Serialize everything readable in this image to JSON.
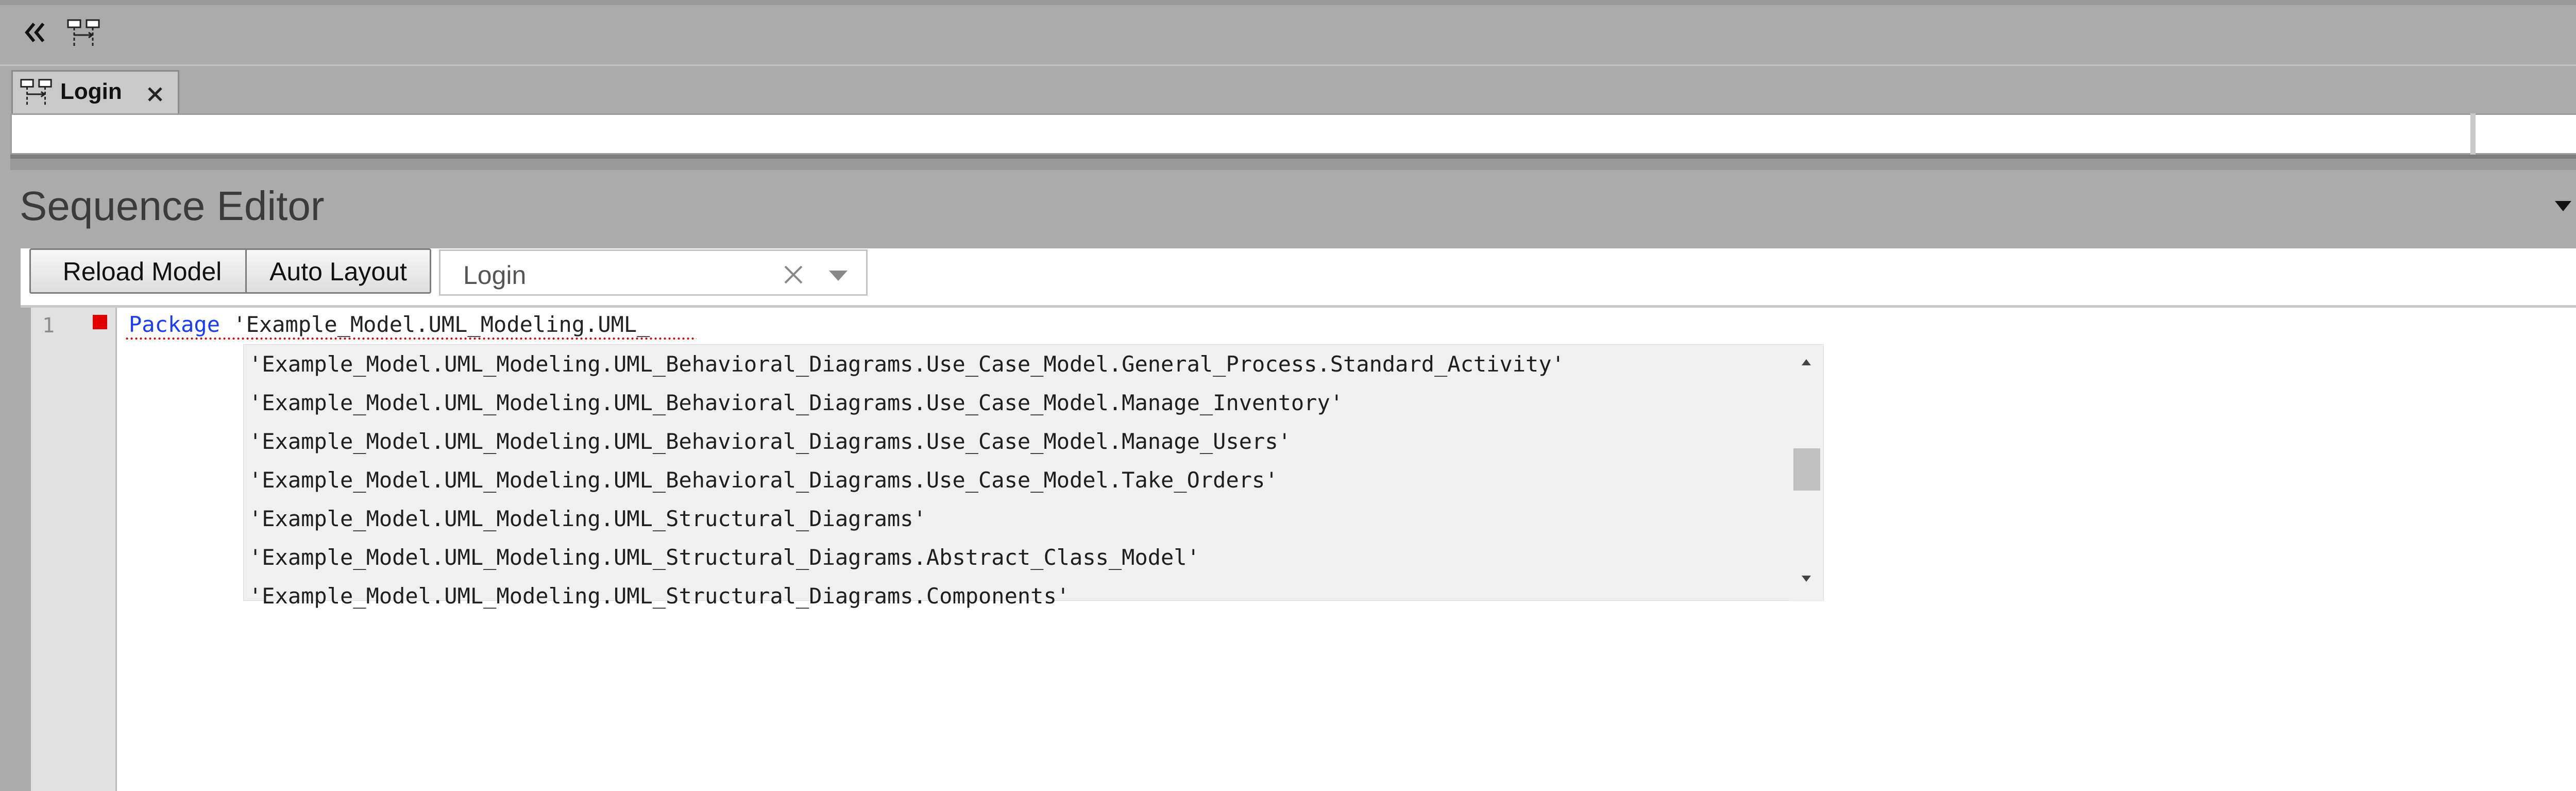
{
  "top_toolbar": {
    "collapse_icon": "double-chevron-left-icon",
    "diagram_icon": "sequence-diagram-icon",
    "dropdown_icon": "chevron-down-icon",
    "close_icon": "close-icon"
  },
  "tab_strip": {
    "tabs": [
      {
        "label": "Login",
        "icon": "sequence-diagram-icon",
        "active": true
      }
    ],
    "prev_icon": "triangle-left-icon",
    "next_icon": "triangle-right-icon"
  },
  "diagram_bar": {
    "dropdown_icon": "chevron-down-icon"
  },
  "panel": {
    "title": "Sequence Editor",
    "menu_icon": "chevron-down-icon",
    "pin_icon": "pin-icon",
    "close_icon": "close-icon"
  },
  "toolbar": {
    "reload_label": "Reload Model",
    "auto_layout_label": "Auto Layout",
    "sequence_select": {
      "value": "Login",
      "clear_icon": "clear-icon",
      "dropdown_icon": "chevron-down-icon"
    }
  },
  "editor": {
    "line_number": "1",
    "keyword": "Package",
    "string": "'Example_Model.UML_Modeling.UML_",
    "breakpoint_color": "#e10000",
    "keyword_color": "#1a3cff"
  },
  "autocomplete": {
    "items": [
      "'Example_Model.UML_Modeling.UML_Behavioral_Diagrams.Use_Case_Model.General_Process.Standard_Activity'",
      "'Example_Model.UML_Modeling.UML_Behavioral_Diagrams.Use_Case_Model.Manage_Inventory'",
      "'Example_Model.UML_Modeling.UML_Behavioral_Diagrams.Use_Case_Model.Manage_Users'",
      "'Example_Model.UML_Modeling.UML_Behavioral_Diagrams.Use_Case_Model.Take_Orders'",
      "'Example_Model.UML_Modeling.UML_Structural_Diagrams'",
      "'Example_Model.UML_Modeling.UML_Structural_Diagrams.Abstract_Class_Model'",
      "'Example_Model.UML_Modeling.UML_Structural_Diagrams.Components'"
    ],
    "scroll_up_icon": "scroll-up-icon",
    "scroll_down_icon": "scroll-down-icon"
  }
}
